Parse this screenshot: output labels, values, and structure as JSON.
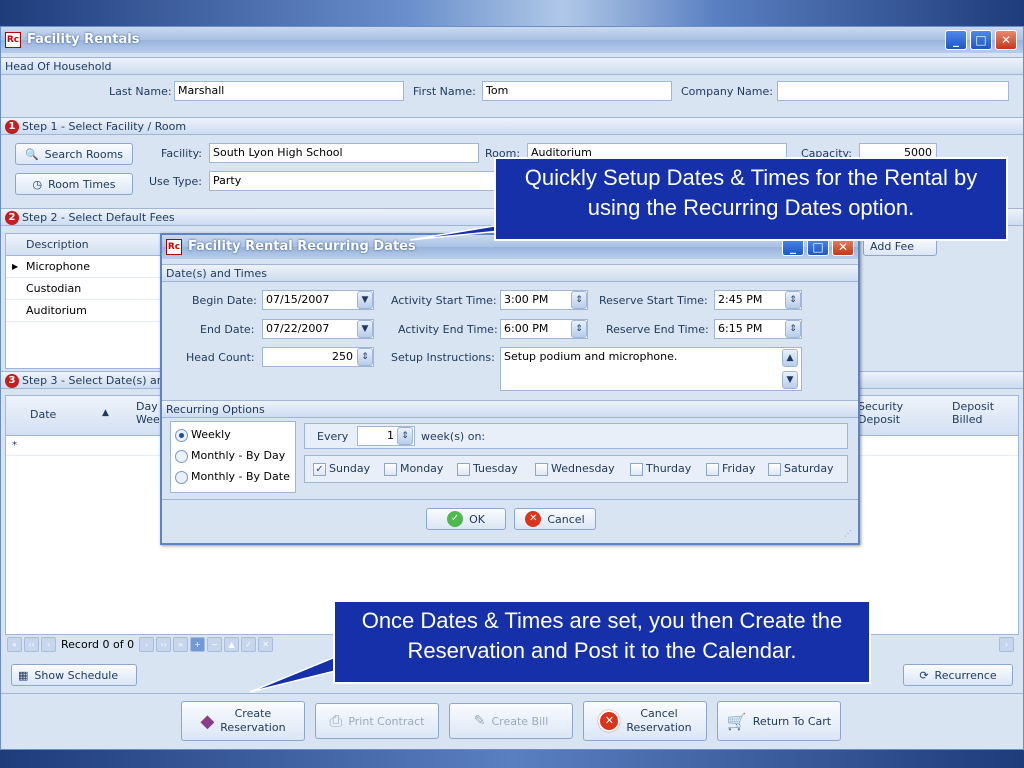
{
  "window": {
    "title": "Facility Rentals"
  },
  "household": {
    "section": "Head Of Household",
    "last_name_label": "Last Name:",
    "last_name": "Marshall",
    "first_name_label": "First Name:",
    "first_name": "Tom",
    "company_label": "Company Name:",
    "company": ""
  },
  "step1": {
    "num": "1",
    "title": "Step 1 - Select Facility / Room",
    "search_rooms": "Search Rooms",
    "room_times": "Room Times",
    "facility_label": "Facility:",
    "facility": "South Lyon High School",
    "use_type_label": "Use Type:",
    "use_type": "Party",
    "room_label": "Room:",
    "room": "Auditorium",
    "capacity_label": "Capacity:",
    "capacity": "5000"
  },
  "step2": {
    "num": "2",
    "title": "Step 2 - Select Default Fees",
    "col_description": "Description",
    "rows": [
      "Microphone",
      "Custodian",
      "Auditorium"
    ],
    "add_fee": "Add Fee"
  },
  "step3": {
    "num": "3",
    "title": "Step 3 - Select Date(s) an",
    "col_date": "Date",
    "col_day": "Day",
    "col_week": "Wee",
    "col_security": "Security",
    "col_security2": "Deposit",
    "col_deposit": "Deposit",
    "col_deposit2": "Billed",
    "new_row": "*",
    "record": "Record 0 of 0",
    "show_schedule": "Show Schedule",
    "recurrence": "Recurrence"
  },
  "bottom_buttons": {
    "create1": "Create",
    "create2": "Reservation",
    "print_contract": "Print Contract",
    "create_bill": "Create Bill",
    "cancel1": "Cancel",
    "cancel2": "Reservation",
    "return_cart": "Return To Cart"
  },
  "dialog": {
    "title": "Facility Rental Recurring Dates",
    "section_dates": "Date(s) and Times",
    "begin_label": "Begin Date:",
    "begin": "07/15/2007",
    "end_label": "End Date:",
    "end": "07/22/2007",
    "head_label": "Head Count:",
    "head": "250",
    "act_start_label": "Activity Start Time:",
    "act_start": "3:00 PM",
    "act_end_label": "Activity End Time:",
    "act_end": "6:00 PM",
    "setup_label": "Setup Instructions:",
    "setup": "Setup podium and microphone.",
    "res_start_label": "Reserve Start Time:",
    "res_start": "2:45 PM",
    "res_end_label": "Reserve End Time:",
    "res_end": "6:15 PM",
    "section_recurring": "Recurring Options",
    "opt_weekly": "Weekly",
    "opt_monthly_day": "Monthly - By Day",
    "opt_monthly_date": "Monthly - By Date",
    "every_label": "Every",
    "every": "1",
    "weeks_on": "week(s) on:",
    "days": [
      "Sunday",
      "Monday",
      "Tuesday",
      "Wednesday",
      "Thurday",
      "Friday",
      "Saturday"
    ],
    "ok": "OK",
    "cancel": "Cancel"
  },
  "callouts": {
    "top": "Quickly Setup Dates & Times for the Rental by using the Recurring Dates option.",
    "bottom": "Once Dates & Times are set, you then Create the Reservation and Post it to the Calendar."
  }
}
